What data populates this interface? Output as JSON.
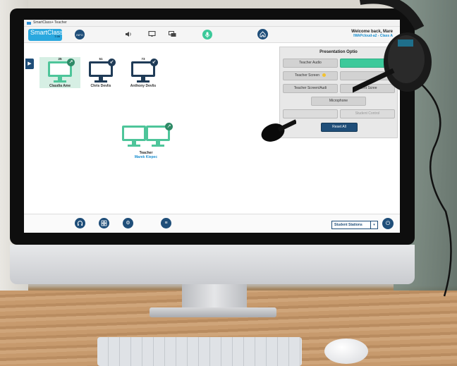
{
  "app": {
    "window_title": "SmartClass+ Teacher",
    "logo_text": "SmartClass",
    "version": "7.00"
  },
  "header": {
    "left_badge": "INFO",
    "welcome": "Welcome back, Mare",
    "class_name": "IWAPcloud-a2 - Class A"
  },
  "stations": [
    {
      "count": "25",
      "name": "Claudia Ame",
      "selected": true,
      "color": "green",
      "arrow": "↗"
    },
    {
      "count": "51",
      "name": "Chris Devlis",
      "selected": false,
      "color": "navy",
      "arrow": "↙"
    },
    {
      "count": "73",
      "name": "Anthony Devlis",
      "selected": false,
      "color": "navy",
      "arrow": "↙"
    }
  ],
  "teacher": {
    "label": "Teacher",
    "name": "Marek Kiepec",
    "arrow": "↗"
  },
  "panel": {
    "title": "Presentation Optio",
    "buttons": {
      "teacher_audio": "Teacher Audio",
      "teacher_screen": "Teacher Screen",
      "teacher_screen_audio": "Teacher Screen/Audi",
      "student_screen": "udent Scree",
      "microphone": "Microphone",
      "student_control": "Student Control",
      "reset_all": "Reset All"
    }
  },
  "footer": {
    "select_value": "Student Stations",
    "caret": "▾"
  },
  "colors": {
    "navy": "#1f4e79",
    "green": "#3cc99a",
    "accent_blue": "#1a8fd0"
  },
  "icons": [
    "volume-icon",
    "monitor-icon",
    "chat-icon",
    "microphone-icon",
    "home-icon",
    "headphones-icon",
    "grid-icon",
    "settings-icon",
    "list-icon",
    "power-icon",
    "panel-toggle-icon"
  ]
}
